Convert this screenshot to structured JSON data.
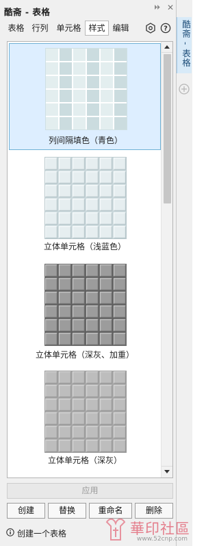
{
  "window": {
    "title": "酷斋 - 表格",
    "pin_glyph": "⏵⏵",
    "close_glyph": "✕"
  },
  "tabs": [
    {
      "label": "表格",
      "active": false
    },
    {
      "label": "行列",
      "active": false
    },
    {
      "label": "单元格",
      "active": false
    },
    {
      "label": "样式",
      "active": true
    },
    {
      "label": "编辑",
      "active": false
    }
  ],
  "toolbar_icons": [
    "settings-hexagon-icon",
    "help-icon"
  ],
  "styles": [
    {
      "label": "列间隔填色（青色）",
      "selected": true,
      "variant": "cyan-column",
      "colors": {
        "bg": "#ffffff",
        "light": "#e3eeef",
        "dark": "#cbdcdf",
        "border": "#cfe0e3"
      }
    },
    {
      "label": "立体单元格（浅蓝色）",
      "selected": false,
      "variant": "raised-light",
      "colors": {
        "bg": "#c9d7db",
        "cell": "#e6eef0",
        "hi": "#f6fafb",
        "lo": "#b9c8cc"
      }
    },
    {
      "label": "立体单元格（深灰、加重）",
      "selected": false,
      "variant": "raised-dark",
      "colors": {
        "bg": "#5e5e5e",
        "cell": "#9c9c9c",
        "hi": "#c4c4c4",
        "lo": "#6c6c6c"
      }
    },
    {
      "label": "立体单元格（深灰）",
      "selected": false,
      "variant": "raised-gray",
      "colors": {
        "bg": "#a6a6a6",
        "cell": "#bdbdbd",
        "hi": "#d4d4d4",
        "lo": "#9a9a9a"
      }
    }
  ],
  "scroll_position": 0.0,
  "apply_label": "应用",
  "buttons": {
    "create": "创建",
    "replace": "替换",
    "rename": "重命名",
    "delete": "删除"
  },
  "status_text": "创建一个表格",
  "dock": {
    "tab_label": "酷斋 - 表格",
    "add_icon": "plus-circle-icon"
  },
  "watermark": {
    "text": "華印社區",
    "url": "www.52cnp.com"
  },
  "colors": {
    "accent": "#6fb1d6",
    "selection_bg": "#ddeeff",
    "dock_tab": "#d8eaf8"
  }
}
